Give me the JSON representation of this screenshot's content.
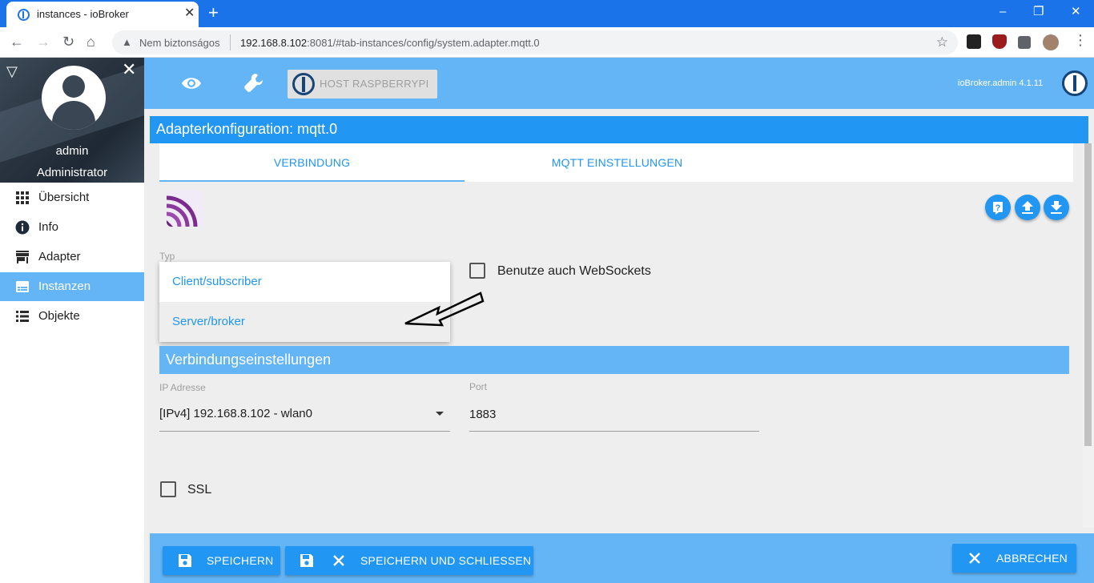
{
  "browser": {
    "tab_title": "instances - ioBroker",
    "tab_close": "✕",
    "new_tab": "+",
    "security_label": "Nem biztonságos",
    "url_host": "192.168.8.102",
    "url_rest": ":8081/#tab-instances/config/system.adapter.mqtt.0",
    "window_controls": [
      "–",
      "❐",
      "✕"
    ]
  },
  "sidebar": {
    "user_name": "admin",
    "user_role": "Administrator",
    "items": [
      {
        "label": "Übersicht",
        "icon": "grid-icon",
        "active": false
      },
      {
        "label": "Info",
        "icon": "info-icon",
        "active": false
      },
      {
        "label": "Adapter",
        "icon": "store-icon",
        "active": false
      },
      {
        "label": "Instanzen",
        "icon": "instances-icon",
        "active": true
      },
      {
        "label": "Objekte",
        "icon": "list-icon",
        "active": false
      }
    ]
  },
  "topbar": {
    "host_label": "HOST RASPBERRYPI",
    "version": "ioBroker.admin 4.1.11"
  },
  "config": {
    "title": "Adapterkonfiguration: mqtt.0",
    "tabs": [
      {
        "label": "VERBINDUNG",
        "active": true
      },
      {
        "label": "MQTT EINSTELLUNGEN",
        "active": false
      }
    ],
    "typ_label": "Typ",
    "typ_options": [
      "Client/subscriber",
      "Server/broker"
    ],
    "typ_selected": "Server/broker",
    "websockets_label": "Benutze auch WebSockets",
    "websockets_checked": false,
    "section_title": "Verbindungseinstellungen",
    "ip_label": "IP Adresse",
    "ip_value": "[IPv4] 192.168.8.102 - wlan0",
    "port_label": "Port",
    "port_value": "1883",
    "ssl_label": "SSL",
    "ssl_checked": false
  },
  "footer": {
    "save_label": "SPEICHERN",
    "save_close_label": "SPEICHERN UND SCHLIESSEN",
    "cancel_label": "ABBRECHEN"
  },
  "colors": {
    "primary": "#2196f3",
    "primary_light": "#64b5f6",
    "chrome_blue": "#1a73e8"
  }
}
